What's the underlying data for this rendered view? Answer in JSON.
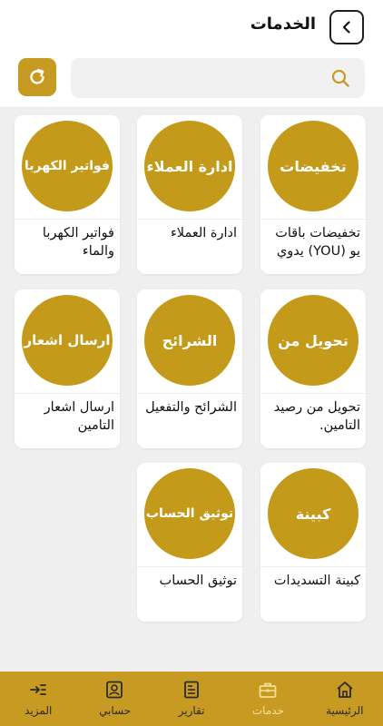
{
  "header": {
    "title": "الخدمات"
  },
  "search": {
    "placeholder": ""
  },
  "colors": {
    "accent": "#c79b22",
    "circle": "#c49a1b",
    "grid_bg": "#efefef",
    "nav_active_text": "#f6df9c"
  },
  "services": [
    {
      "circle_text": "تخفيضات",
      "label": "تخفيضات باقات يو (YOU) يدوي",
      "icon": "service-circle"
    },
    {
      "circle_text": "ادارة العملاء",
      "label": "ادارة العملاء",
      "icon": "service-circle"
    },
    {
      "circle_text": "فواتير الكهربا",
      "label": "فواتير الكهربا والماء",
      "icon": "service-circle"
    },
    {
      "circle_text": "تحويل من",
      "label": "تحويل من رصيد التامين.",
      "icon": "service-circle"
    },
    {
      "circle_text": "الشرائح",
      "label": "الشرائح والتفعيل",
      "icon": "service-circle"
    },
    {
      "circle_text": "ارسال اشعار",
      "label": "ارسال اشعار التامين",
      "icon": "service-circle"
    },
    {
      "circle_text": "كبينة",
      "label": "كبينة التسديدات",
      "icon": "service-circle"
    },
    {
      "circle_text": "توثيق الحساب",
      "label": "توثيق الحساب",
      "icon": "service-circle"
    }
  ],
  "nav": [
    {
      "label": "الرئيسية",
      "icon": "home-icon"
    },
    {
      "label": "خدمات",
      "icon": "briefcase-icon",
      "active": true
    },
    {
      "label": "تقارير",
      "icon": "report-icon"
    },
    {
      "label": "حسابي",
      "icon": "account-icon"
    },
    {
      "label": "المزيد",
      "icon": "more-icon"
    }
  ]
}
